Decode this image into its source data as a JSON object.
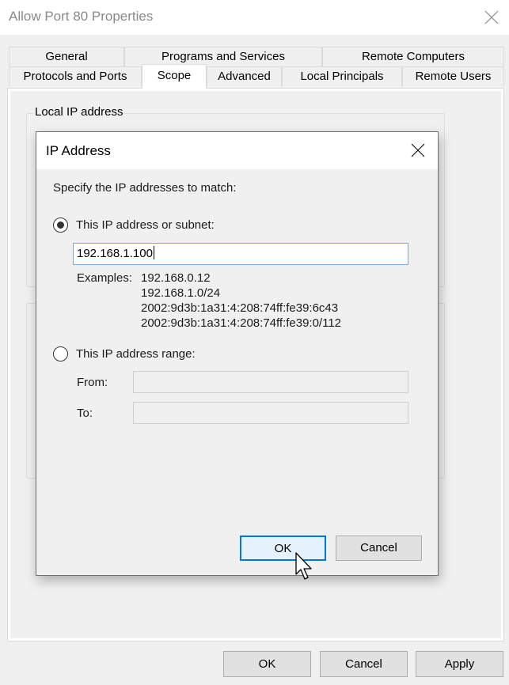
{
  "window": {
    "title": "Allow Port 80 Properties",
    "close_icon": "close-icon"
  },
  "tabs": {
    "row1": [
      {
        "label": "General"
      },
      {
        "label": "Programs and Services"
      },
      {
        "label": "Remote Computers"
      }
    ],
    "row2": [
      {
        "label": "Protocols and Ports"
      },
      {
        "label": "Scope",
        "active": true
      },
      {
        "label": "Advanced"
      },
      {
        "label": "Local Principals"
      },
      {
        "label": "Remote Users"
      }
    ]
  },
  "scope_panel": {
    "local_ip_group_label": "Local IP address"
  },
  "footer": {
    "ok_label": "OK",
    "cancel_label": "Cancel",
    "apply_label": "Apply"
  },
  "ip_dialog": {
    "title": "IP Address",
    "instruction": "Specify the IP addresses to match:",
    "option_single": {
      "label": "This IP address or subnet:",
      "selected": true,
      "value": "192.168.1.100"
    },
    "examples_label": "Examples:",
    "examples": [
      "192.168.0.12",
      "192.168.1.0/24",
      "2002:9d3b:1a31:4:208:74ff:fe39:6c43",
      "2002:9d3b:1a31:4:208:74ff:fe39:0/112"
    ],
    "option_range": {
      "label": "This IP address range:",
      "selected": false,
      "from_label": "From:",
      "to_label": "To:",
      "from_value": "",
      "to_value": ""
    },
    "ok_label": "OK",
    "cancel_label": "Cancel"
  },
  "colors": {
    "accent": "#0078d7",
    "default_button_bg": "#e5f1fb",
    "dialog_bg": "#f0f0f0"
  }
}
